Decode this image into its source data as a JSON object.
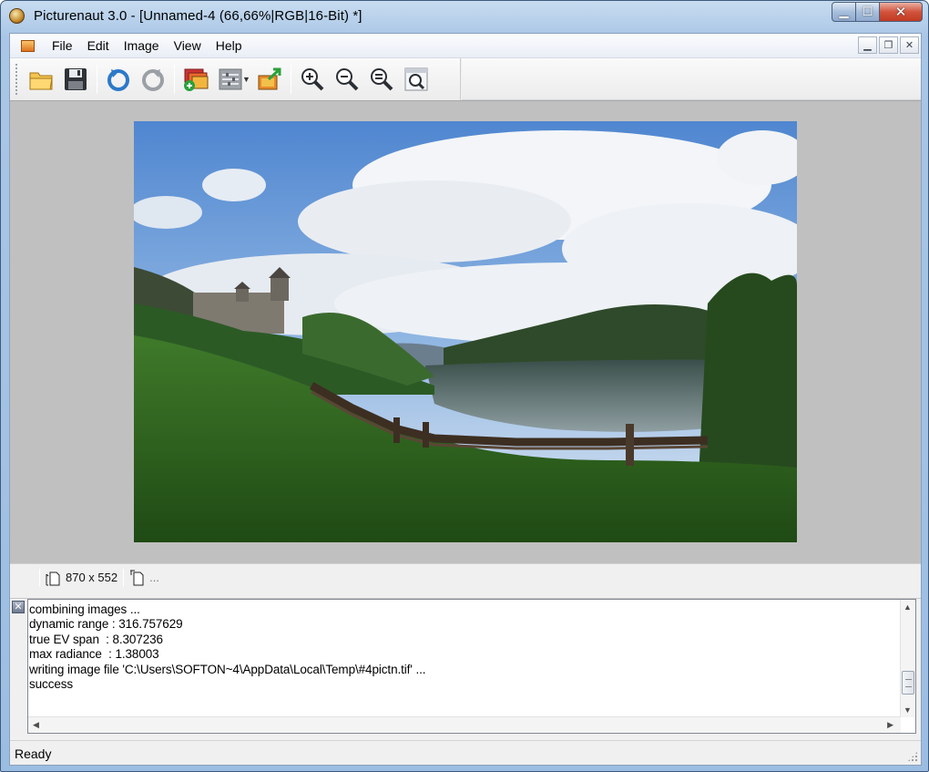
{
  "window": {
    "title": "Picturenaut 3.0 - [Unnamed-4 (66,66%|RGB|16-Bit) *]",
    "buttons": {
      "minimize": "▁",
      "maximize": "☐",
      "close": "✕"
    }
  },
  "menubar": {
    "items": [
      "File",
      "Edit",
      "Image",
      "View",
      "Help"
    ],
    "mdi_buttons": {
      "minimize": "▁",
      "restore": "❐",
      "close": "✕"
    }
  },
  "toolbar": {
    "icons": [
      "open-folder-icon",
      "save-icon",
      "undo-icon",
      "redo-icon",
      "add-layers-icon",
      "adjust-icon",
      "export-icon",
      "zoom-in-icon",
      "zoom-out-icon",
      "zoom-fit-icon",
      "zoom-window-icon"
    ]
  },
  "infobar": {
    "dimensions": "870 x 552",
    "extra": "..."
  },
  "log": {
    "lines": [
      "combining images ...",
      "dynamic range : 316.757629",
      "true EV span  : 8.307236",
      "max radiance  : 1.38003",
      "writing image file 'C:\\Users\\SOFTON~4\\AppData\\Local\\Temp\\#4pictn.tif' ...",
      "success"
    ],
    "text": "combining images ...\ndynamic range : 316.757629\ntrue EV span  : 8.307236\nmax radiance  : 1.38003\nwriting image file 'C:\\Users\\SOFTON~4\\AppData\\Local\\Temp\\#4pictn.tif' ...\nsuccess",
    "close_glyph": "✕",
    "scroll_up": "▲",
    "scroll_down": "▼",
    "scroll_left": "◀",
    "scroll_right": "▶"
  },
  "status": {
    "text": "Ready"
  },
  "colors": {
    "accent": "#3d5a7d",
    "close": "#c13a22"
  }
}
